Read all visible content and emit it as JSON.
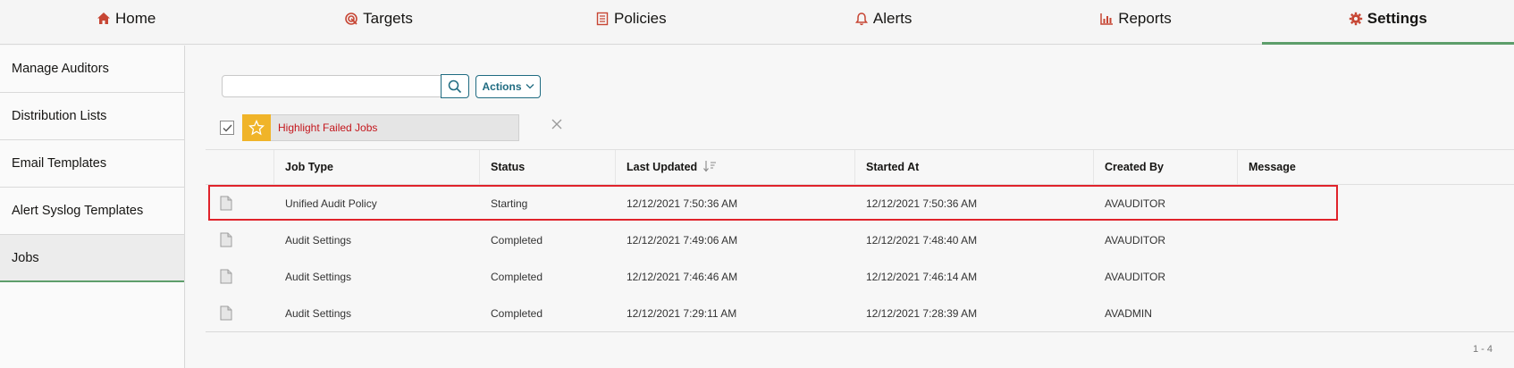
{
  "nav": {
    "tabs": [
      {
        "label": "Home",
        "icon": "home-icon"
      },
      {
        "label": "Targets",
        "icon": "targets-icon"
      },
      {
        "label": "Policies",
        "icon": "policies-icon"
      },
      {
        "label": "Alerts",
        "icon": "bell-icon"
      },
      {
        "label": "Reports",
        "icon": "chart-icon"
      },
      {
        "label": "Settings",
        "icon": "gear-icon",
        "active": true
      }
    ]
  },
  "sidebar": {
    "items": [
      {
        "label": "Manage Auditors"
      },
      {
        "label": "Distribution Lists"
      },
      {
        "label": "Email Templates"
      },
      {
        "label": "Alert Syslog Templates"
      },
      {
        "label": "Jobs",
        "active": true
      }
    ]
  },
  "toolbar": {
    "search_value": "",
    "actions_label": "Actions"
  },
  "filter": {
    "checked": true,
    "label": "Highlight Failed Jobs"
  },
  "table": {
    "columns": [
      "Job Type",
      "Status",
      "Last Updated",
      "Started At",
      "Created By",
      "Message"
    ],
    "rows": [
      {
        "job_type": "Unified Audit Policy",
        "status": "Starting",
        "last_updated": "12/12/2021 7:50:36 AM",
        "started_at": "12/12/2021 7:50:36 AM",
        "created_by": "AVAUDITOR",
        "message": ""
      },
      {
        "job_type": "Audit Settings",
        "status": "Completed",
        "last_updated": "12/12/2021 7:49:06 AM",
        "started_at": "12/12/2021 7:48:40 AM",
        "created_by": "AVAUDITOR",
        "message": ""
      },
      {
        "job_type": "Audit Settings",
        "status": "Completed",
        "last_updated": "12/12/2021 7:46:46 AM",
        "started_at": "12/12/2021 7:46:14 AM",
        "created_by": "AVAUDITOR",
        "message": ""
      },
      {
        "job_type": "Audit Settings",
        "status": "Completed",
        "last_updated": "12/12/2021 7:29:11 AM",
        "started_at": "12/12/2021 7:28:39 AM",
        "created_by": "AVADMIN",
        "message": ""
      }
    ]
  },
  "pager": {
    "range": "1 - 4"
  },
  "colors": {
    "accent": "#c74634",
    "active_underline": "#5d9e6b",
    "highlight": "#e0232b",
    "chip_star": "#f0b429"
  }
}
